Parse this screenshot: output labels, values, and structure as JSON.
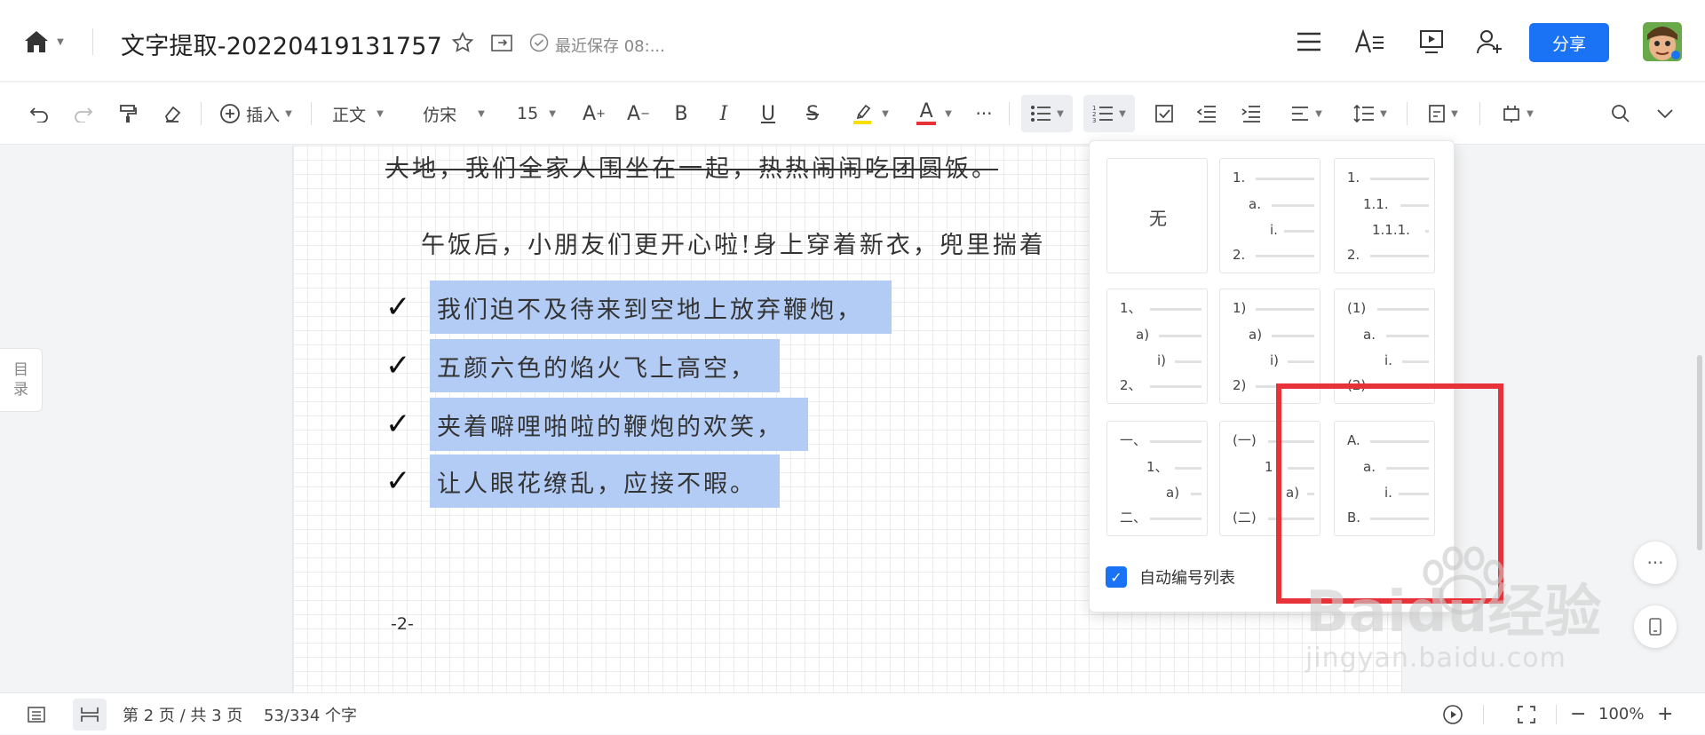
{
  "header": {
    "title": "文字提取-20220419131757",
    "save_status": "最近保存 08:...",
    "share_label": "分享"
  },
  "toolbar": {
    "insert_label": "插入",
    "style_label": "正文",
    "font_label": "仿宋",
    "size_label": "15",
    "bold_label": "B",
    "italic_label": "I",
    "underline_label": "U",
    "strike_label": "S",
    "font_color_label": "A",
    "more_label": "···",
    "font_color": "#e8323a",
    "highlight_color": "#f5e000"
  },
  "document": {
    "line1": "大地，我们全家人围坐在一起，热热闹闹吃团圆饭。",
    "line2": "午饭后，小朋友们更开心啦!身上穿着新衣，兜里揣着",
    "check_items": [
      "我们迫不及待来到空地上放弃鞭炮，",
      "五颜六色的焰火飞上高空，",
      "夹着噼哩啪啦的鞭炮的欢笑，",
      "让人眼花缭乱，应接不暇。"
    ],
    "page_number": "-2-",
    "toc_label_1": "目",
    "toc_label_2": "录"
  },
  "list_panel": {
    "none_label": "无",
    "options": [
      {
        "labels": [
          "1.",
          "a.",
          "i.",
          "2."
        ]
      },
      {
        "labels": [
          "1.",
          "1.1.",
          "1.1.1.",
          "2."
        ]
      },
      {
        "labels": [
          "1、",
          "a)",
          "i)",
          "2、"
        ]
      },
      {
        "labels": [
          "1)",
          "a)",
          "i)",
          "2)"
        ]
      },
      {
        "labels": [
          "(1)",
          "a.",
          "i.",
          "(2)"
        ]
      },
      {
        "labels": [
          "一、",
          "1、",
          "a)",
          "二、"
        ]
      },
      {
        "labels": [
          "(一)",
          "1",
          "a)",
          "(二)"
        ]
      },
      {
        "labels": [
          "A.",
          "a.",
          "i.",
          "B."
        ]
      }
    ],
    "auto_label": "自动编号列表"
  },
  "statusbar": {
    "page_info": "第 2 页 / 共 3 页",
    "word_count": "53/334 个字",
    "zoom": "100%",
    "zoom_out": "−",
    "zoom_in": "+"
  },
  "watermark": {
    "text": "Baidu经验",
    "url": "jingyan.baidu.com"
  }
}
